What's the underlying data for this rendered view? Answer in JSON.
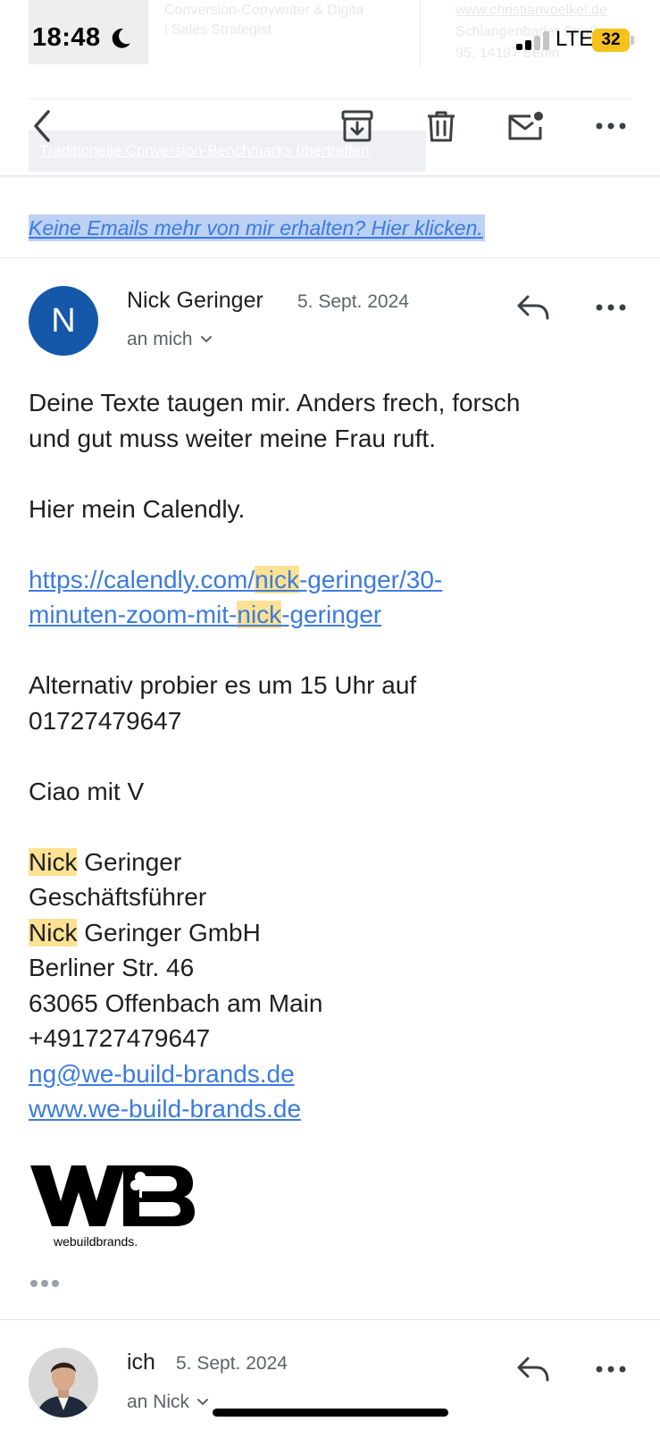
{
  "status_bar": {
    "time": "18:48",
    "network": "LTE",
    "battery": "32",
    "icons": [
      "moon-icon",
      "signal-icon"
    ]
  },
  "background_mail": {
    "role": "Conversion-Copywriter & Digita",
    "role2": "l Sales Strategist",
    "website": "www.christianvoelkel.de",
    "street": "Schlangenbader Straße",
    "address": "95, 14197 Berlin",
    "cta": "Traditionelle Conversion-Benchmarks übertreffen"
  },
  "toolbar": {
    "icons": [
      "back-icon",
      "archive-icon",
      "trash-icon",
      "mark-unread-icon",
      "more-icon"
    ]
  },
  "unsubscribe_link": "Keine Emails mehr von mir erhalten? Hier klicken.",
  "message1": {
    "avatar_letter": "N",
    "sender": "Nick Geringer",
    "date": "5. Sept. 2024",
    "recipient": "an mich",
    "body": {
      "line1": "Deine Texte taugen mir. Anders frech, forsch",
      "line2": "und gut muss weiter meine Frau ruft.",
      "line3": "Hier mein Calendly.",
      "link_part1": "https://calendly.com/",
      "link_hl1": "nick",
      "link_part2": "-geringer/30-",
      "link_part3": "minuten-zoom-mit-",
      "link_hl2": "nick",
      "link_part4": "-geringer",
      "line4": "Alternativ probier es um 15 Uhr auf",
      "line5": "01727479647",
      "line6": "Ciao mit V"
    },
    "signature": {
      "first_name": "Nick",
      "last_name": " Geringer",
      "title": "Geschäftsführer",
      "company_hl": "Nick",
      "company_rest": " Geringer GmbH",
      "street": "Berliner Str. 46",
      "city": "63065 Offenbach am Main",
      "phone": "+491727479647",
      "email": "ng@we-build-brands.de",
      "website": "www.we-build-brands.de"
    },
    "logo_text": "webuildbrands."
  },
  "message2": {
    "sender": "ich",
    "date": "5. Sept. 2024",
    "recipient": "an Nick"
  }
}
